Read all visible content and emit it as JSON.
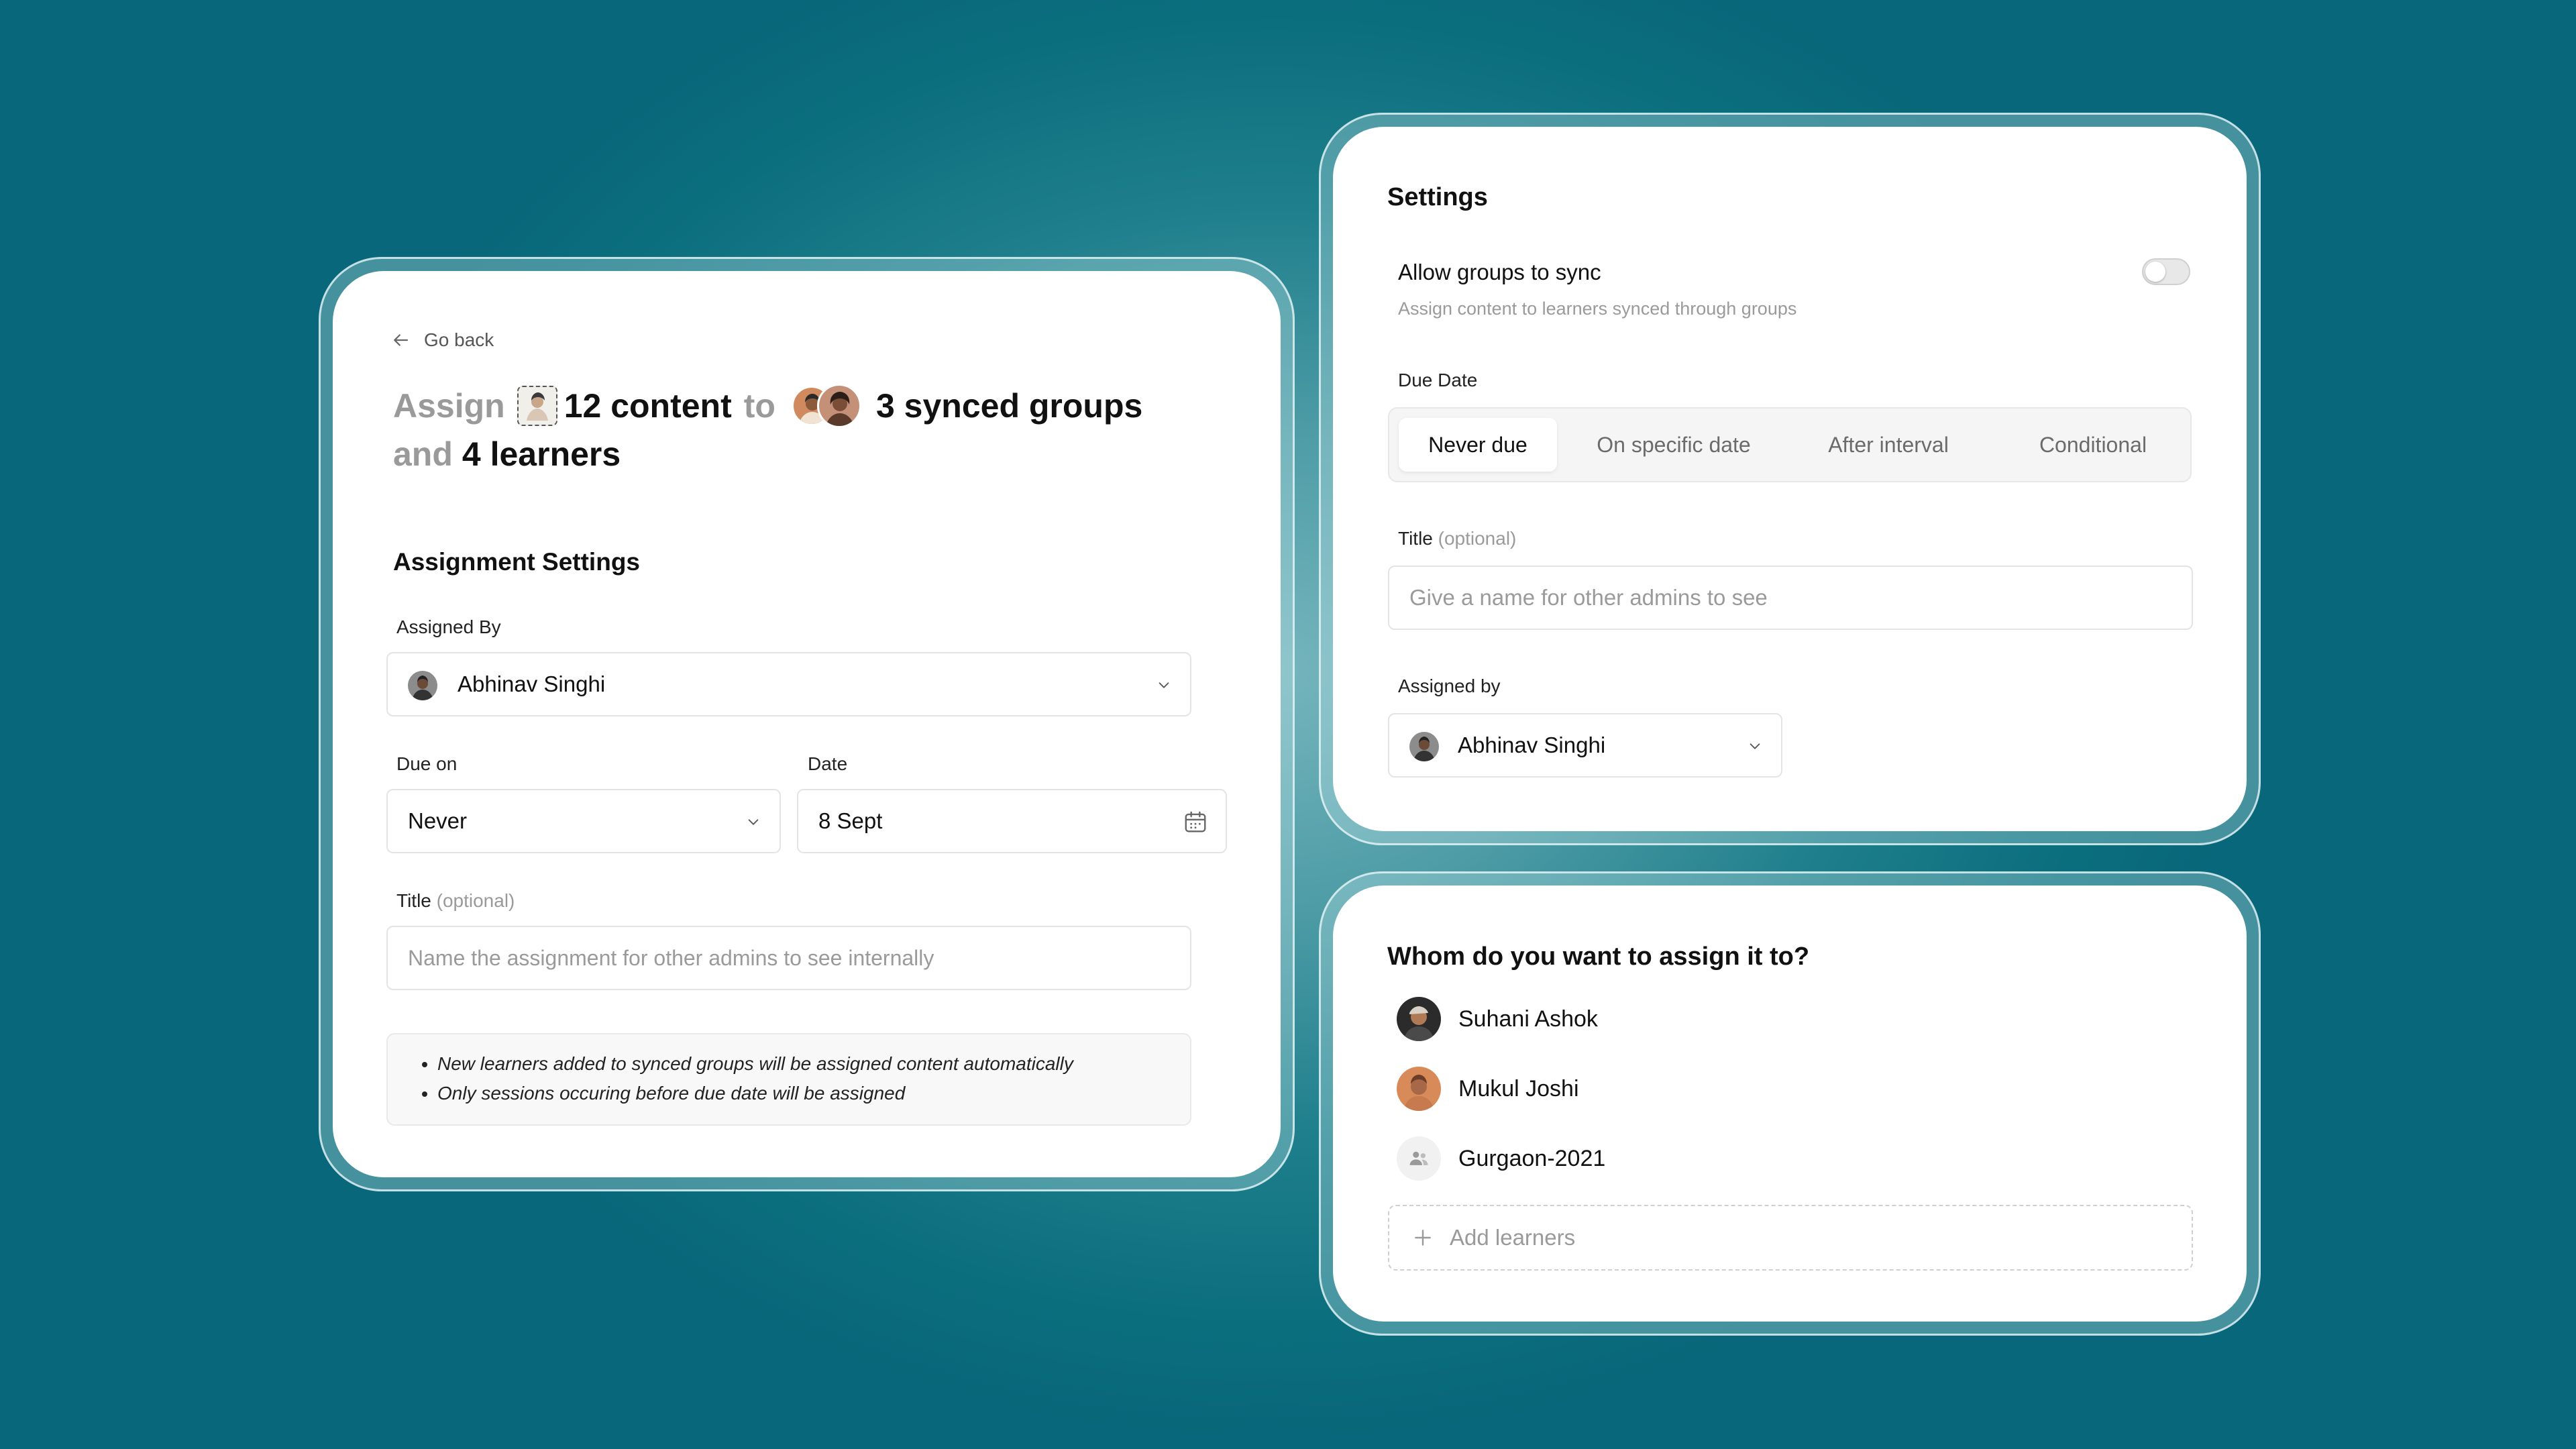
{
  "left_panel": {
    "back_label": "Go back",
    "headline": {
      "word_assign": "Assign",
      "content_count": "12 content",
      "word_to": "to",
      "groups_count": "3 synced groups",
      "word_and": "and",
      "learners_count": "4 learners"
    },
    "section_title": "Assignment Settings",
    "assigned_by": {
      "label": "Assigned By",
      "value": "Abhinav Singhi"
    },
    "due_on": {
      "label": "Due on",
      "value": "Never"
    },
    "date": {
      "label": "Date",
      "value": "8 Sept"
    },
    "title_field": {
      "label": "Title",
      "optional": "(optional)",
      "placeholder": "Name the assignment for other admins to see internally"
    },
    "notes": [
      "New learners added to synced groups will be assigned content automatically",
      "Only sessions occuring before due date will be assigned"
    ]
  },
  "settings_panel": {
    "title": "Settings",
    "sync_toggle": {
      "label": "Allow groups to sync",
      "description": "Assign content to learners synced through groups",
      "enabled": false
    },
    "due_date": {
      "label": "Due Date",
      "options": [
        "Never due",
        "On specific date",
        "After interval",
        "Conditional"
      ],
      "selected": "Never due"
    },
    "title_field": {
      "label": "Title",
      "optional": "(optional)",
      "placeholder": "Give a name for other admins to see"
    },
    "assigned_by": {
      "label": "Assigned by",
      "value": "Abhinav Singhi"
    }
  },
  "assign_panel": {
    "title": "Whom do you want to assign it to?",
    "assignees": [
      {
        "name": "Suhani Ashok",
        "type": "learner"
      },
      {
        "name": "Mukul Joshi",
        "type": "learner"
      },
      {
        "name": "Gurgaon-2021",
        "type": "group"
      }
    ],
    "add_label": "Add learners"
  },
  "colors": {
    "background": "#0b6e7d",
    "background_glow": "#76b5bd",
    "card": "#ffffff",
    "muted_text": "#9a9a9a",
    "border": "#e4e4e4"
  }
}
